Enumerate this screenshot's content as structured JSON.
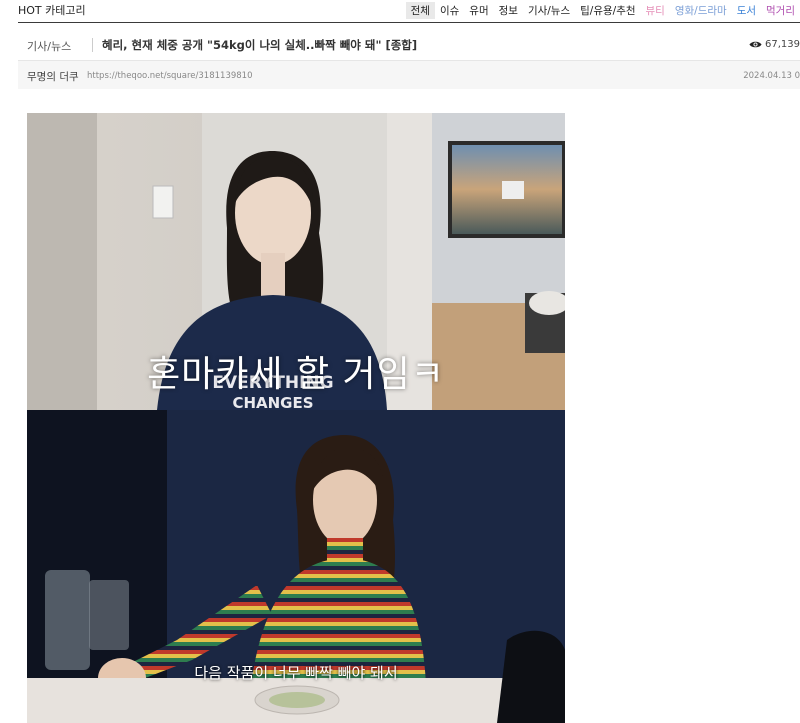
{
  "topbar": {
    "brand_hot": "HOT",
    "brand_cat": "카테고리",
    "categories": [
      {
        "label": "전체",
        "color": "#222222"
      },
      {
        "label": "이슈",
        "color": "#222222"
      },
      {
        "label": "유머",
        "color": "#222222"
      },
      {
        "label": "정보",
        "color": "#222222"
      },
      {
        "label": "기사/뉴스",
        "color": "#222222"
      },
      {
        "label": "팁/유용/추천",
        "color": "#222222"
      },
      {
        "label": "뷰티",
        "color": "#e58fb8"
      },
      {
        "label": "영화/드라마",
        "color": "#7a9ed6"
      },
      {
        "label": "도서",
        "color": "#3c82d6"
      },
      {
        "label": "먹거리",
        "color": "#b050b0"
      }
    ]
  },
  "post": {
    "category": "기사/뉴스",
    "title": "혜리, 현재 체중 공개 \"54kg이 나의 실체..빠짝 빼야 돼\" [종합]",
    "views": "67,139",
    "author": "무명의 더쿠",
    "url": "https://theqoo.net/square/3181139810",
    "date": "2024.04.13 0"
  },
  "images": {
    "caption_top": "혼마카세 할 거임ㅋ",
    "shirt_text_1": "EVERYTHING",
    "shirt_text_2": "CHANGES",
    "caption_bottom": "다음 작품이 너무 빠짝 빼야 돼서"
  },
  "colors": {
    "active_tab_bg": "#e9e9e9",
    "meta_bg": "#f6f6f6"
  }
}
